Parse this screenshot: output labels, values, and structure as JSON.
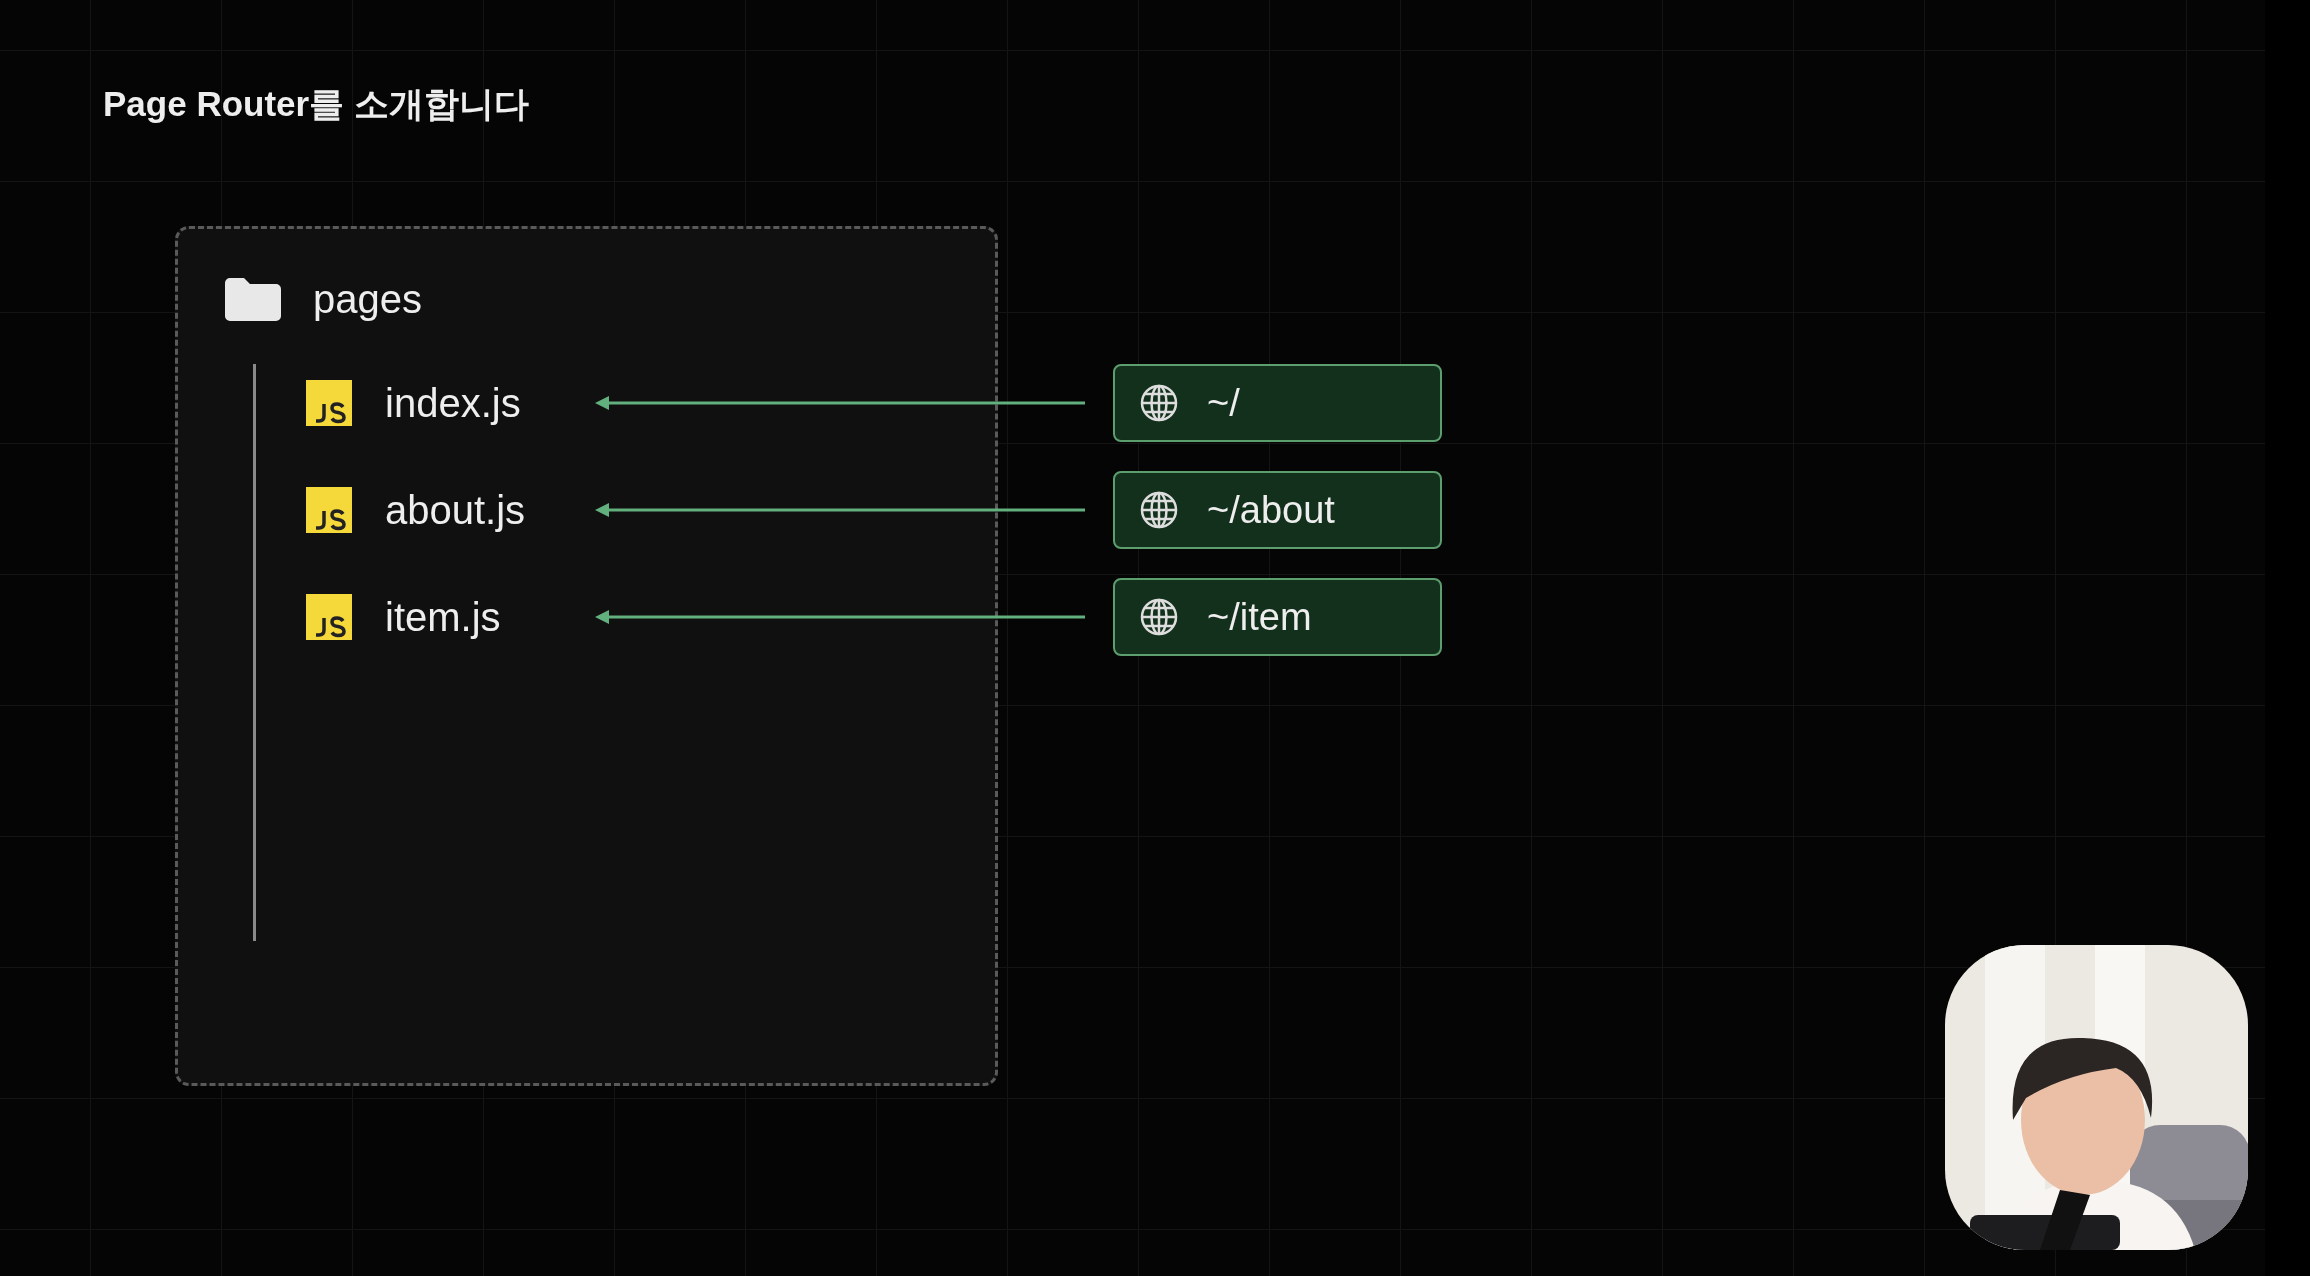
{
  "title": "Page Router를 소개합니다",
  "folder": {
    "name": "pages"
  },
  "files": [
    {
      "name": "index.js",
      "route": "~/"
    },
    {
      "name": "about.js",
      "route": "~/about"
    },
    {
      "name": "item.js",
      "route": "~/item"
    }
  ]
}
